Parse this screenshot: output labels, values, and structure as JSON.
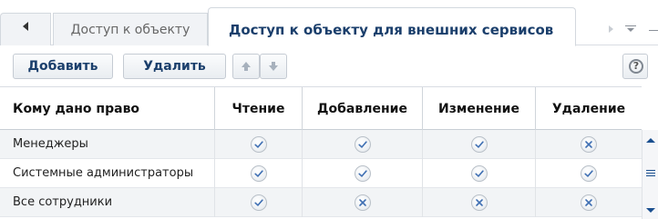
{
  "tabs": [
    {
      "label": "Доступ к объекту",
      "active": false
    },
    {
      "label": "Доступ к объекту для внешних сервисов",
      "active": true
    }
  ],
  "toolbar": {
    "add_label": "Добавить",
    "delete_label": "Удалить",
    "move_up_icon": "arrow-up-icon",
    "move_down_icon": "arrow-down-icon",
    "help_icon": "help-icon",
    "help_glyph": "?"
  },
  "grid": {
    "columns": [
      "Кому дано право",
      "Чтение",
      "Добавление",
      "Изменение",
      "Удаление"
    ],
    "rows": [
      {
        "name": "Менеджеры",
        "read": true,
        "add": true,
        "edit": true,
        "delete": false
      },
      {
        "name": "Системные администраторы",
        "read": true,
        "add": true,
        "edit": true,
        "delete": true
      },
      {
        "name": "Все сотрудники",
        "read": true,
        "add": false,
        "edit": false,
        "delete": false
      }
    ]
  },
  "colors": {
    "accent_text": "#1b3f6c",
    "check": "#3f6fb3",
    "cross": "#3f6fb3",
    "scroll_arrow": "#1a4f8f"
  }
}
